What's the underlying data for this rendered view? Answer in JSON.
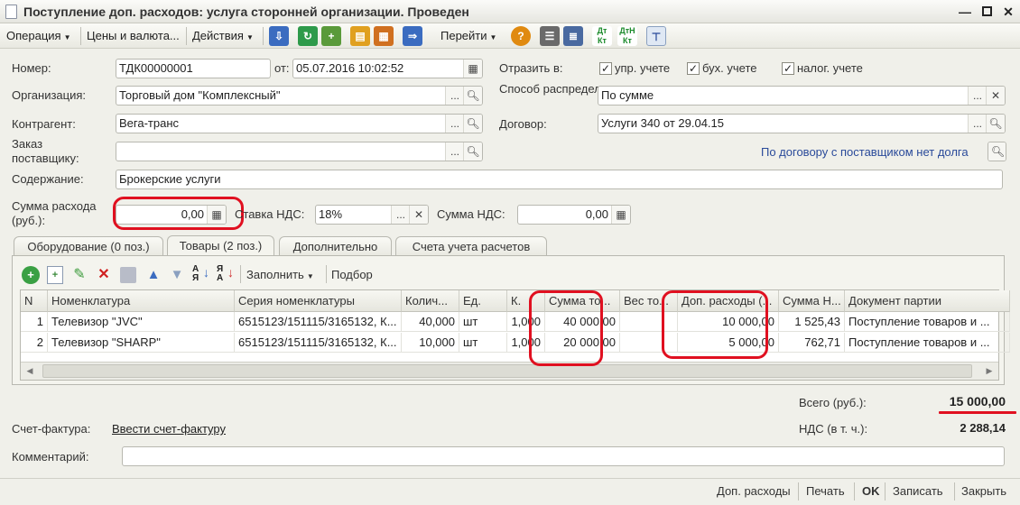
{
  "window": {
    "title": "Поступление доп. расходов: услуга сторонней организации. Проведен"
  },
  "toolbar": {
    "operation": "Операция",
    "prices": "Цены и валюта...",
    "actions": "Действия",
    "goto": "Перейти",
    "fill": "Заполнить",
    "selection": "Подбор"
  },
  "form": {
    "number_label": "Номер:",
    "number": "ТДК00000001",
    "from_label": "от:",
    "date": "05.07.2016 10:02:52",
    "reflect_label": "Отразить в:",
    "checks": [
      {
        "label": "упр. учете",
        "checked": true
      },
      {
        "label": "бух. учете",
        "checked": true
      },
      {
        "label": "налог. учете",
        "checked": true
      }
    ],
    "org_label": "Организация:",
    "org": "Торговый дом \"Комплексный\"",
    "dist_label": "Способ распределения:",
    "dist": "По сумме",
    "contractor_label": "Контрагент:",
    "contractor": "Вега-транс",
    "contract_label": "Договор:",
    "contract": "Услуги 340 от 29.04.15",
    "order_label": "Заказ поставщику:",
    "order": "",
    "debt_link": "По договору с поставщиком нет долга",
    "content_label": "Содержание:",
    "content": "Брокерские услуги",
    "sum_label": "Сумма расхода (руб.):",
    "sum": "0,00",
    "vat_rate_label": "Ставка НДС:",
    "vat_rate": "18%",
    "vat_sum_label": "Сумма НДС:",
    "vat_sum": "0,00"
  },
  "tabs": [
    "Оборудование (0 поз.)",
    "Товары (2 поз.)",
    "Дополнительно",
    "Счета учета расчетов"
  ],
  "table": {
    "columns": [
      "N",
      "Номенклатура",
      "Серия номенклатуры",
      "Колич...",
      "Ед.",
      "К.",
      "Сумма то...",
      "Вес то...",
      "Доп. расходы (...",
      "Сумма Н...",
      "Документ партии"
    ],
    "rows": [
      [
        "1",
        "Телевизор \"JVC\"",
        "6515123/151115/3165132, К...",
        "40,000",
        "шт",
        "1,000",
        "40 000,00",
        "",
        "10 000,00",
        "1 525,43",
        "Поступление товаров и ..."
      ],
      [
        "2",
        "Телевизор \"SHARP\"",
        "6515123/151115/3165132, К...",
        "10,000",
        "шт",
        "1,000",
        "20 000,00",
        "",
        "5 000,00",
        "762,71",
        "Поступление товаров и ..."
      ]
    ]
  },
  "totals": {
    "total_label": "Всего (руб.):",
    "total": "15 000,00",
    "vat_label": "НДС (в т. ч.):",
    "vat": "2 288,14"
  },
  "invoice": {
    "label": "Счет-фактура:",
    "link": "Ввести счет-фактуру"
  },
  "comment": {
    "label": "Комментарий:",
    "value": ""
  },
  "buttons": {
    "extra": "Доп. расходы",
    "print": "Печать",
    "ok": "OK",
    "save": "Записать",
    "close": "Закрыть"
  },
  "colors": {
    "highlight": "#e01020",
    "link": "#2a4a9a"
  }
}
